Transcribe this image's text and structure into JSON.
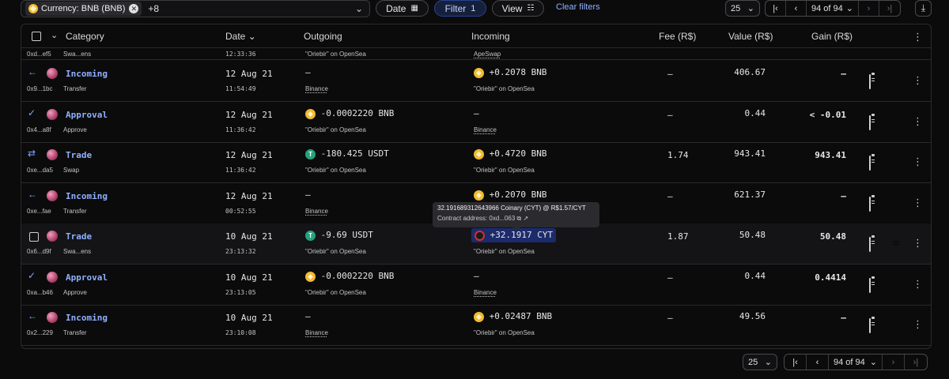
{
  "toolbar": {
    "currency_chip": "Currency: BNB (BNB)",
    "more_count": "+8",
    "date_label": "Date",
    "filter_label": "Filter",
    "filter_count": "1",
    "view_label": "View",
    "clear_filters": "Clear filters",
    "page_size": "25",
    "page_indicator": "94 of 94"
  },
  "table": {
    "headers": {
      "category": "Category",
      "date": "Date",
      "outgoing": "Outgoing",
      "incoming": "Incoming",
      "fee": "Fee (R$)",
      "value": "Value (R$)",
      "gain": "Gain (R$)"
    },
    "partial_row": {
      "hash": "0xd...ef5",
      "sub": "Swa...ens",
      "time": "12:33:36",
      "out_sub": "\"Oriebir\" on OpenSea",
      "in_sub": "ApeSwap"
    },
    "rows": [
      {
        "icon": "←",
        "label": "Incoming",
        "hash": "0x9...1bc",
        "sub": "Transfer",
        "date": "12 Aug 21",
        "time": "11:54:49",
        "out_main": "–",
        "out_sub": "Binance",
        "in_main": "+0.2078 BNB",
        "in_sub": "\"Oriebir\" on OpenSea",
        "fee": "–",
        "value": "406.67",
        "gain": "–"
      },
      {
        "icon": "✓",
        "label": "Approval",
        "hash": "0x4...a8f",
        "sub": "Approve",
        "date": "12 Aug 21",
        "time": "11:36:42",
        "out_main": "-0.0002220 BNB",
        "out_sub": "\"Oriebir\" on OpenSea",
        "in_main": "–",
        "in_sub": "Binance",
        "fee": "–",
        "value": "0.44",
        "gain": "< -0.01"
      },
      {
        "icon": "⇄",
        "label": "Trade",
        "hash": "0xe...da5",
        "sub": "Swap",
        "date": "12 Aug 21",
        "time": "11:36:42",
        "out_main": "-180.425 USDT",
        "out_sub": "\"Oriebir\" on OpenSea",
        "in_main": "+0.4720 BNB",
        "in_sub": "\"Oriebir\" on OpenSea",
        "fee": "1.74",
        "value": "943.41",
        "gain": "943.41"
      },
      {
        "icon": "←",
        "label": "Incoming",
        "hash": "0xe...fae",
        "sub": "Transfer",
        "date": "12 Aug 21",
        "time": "00:52:55",
        "out_main": "–",
        "out_sub": "Binance",
        "in_main": "+0.2070 BNB",
        "in_sub": "",
        "fee": "–",
        "value": "621.37",
        "gain": "–"
      },
      {
        "icon": "☐",
        "label": "Trade",
        "hash": "0x6...d9f",
        "sub": "Swa...ens",
        "date": "10 Aug 21",
        "time": "23:13:32",
        "out_main": "-9.69 USDT",
        "out_sub": "\"Oriebir\" on OpenSea",
        "in_main": "+32.1917 CYT",
        "in_sub": "\"Oriebir\" on OpenSea",
        "fee": "1.87",
        "value": "50.48",
        "gain": "50.48"
      },
      {
        "icon": "✓",
        "label": "Approval",
        "hash": "0xa...b46",
        "sub": "Approve",
        "date": "10 Aug 21",
        "time": "23:13:05",
        "out_main": "-0.0002220 BNB",
        "out_sub": "\"Oriebir\" on OpenSea",
        "in_main": "–",
        "in_sub": "Binance",
        "fee": "–",
        "value": "0.44",
        "gain": "0.4414"
      },
      {
        "icon": "←",
        "label": "Incoming",
        "hash": "0x2...229",
        "sub": "Transfer",
        "date": "10 Aug 21",
        "time": "23:10:08",
        "out_main": "–",
        "out_sub": "Binance",
        "in_main": "+0.02487 BNB",
        "in_sub": "\"Oriebir\" on OpenSea",
        "fee": "–",
        "value": "49.56",
        "gain": "–"
      }
    ]
  },
  "tooltip": {
    "line1": "32.191689312643966 Coinary (CYT) @ R$1.57/CYT",
    "line2": "Contract address: 0xd...063"
  },
  "footer": {
    "page_size": "25",
    "page_indicator": "94 of 94"
  },
  "colors": {
    "background": "#0b0b0c",
    "accent_link": "#8fb0ff",
    "filter_bg": "#15203d",
    "bnb": "#f3ba2f",
    "usdt": "#26a17b"
  }
}
